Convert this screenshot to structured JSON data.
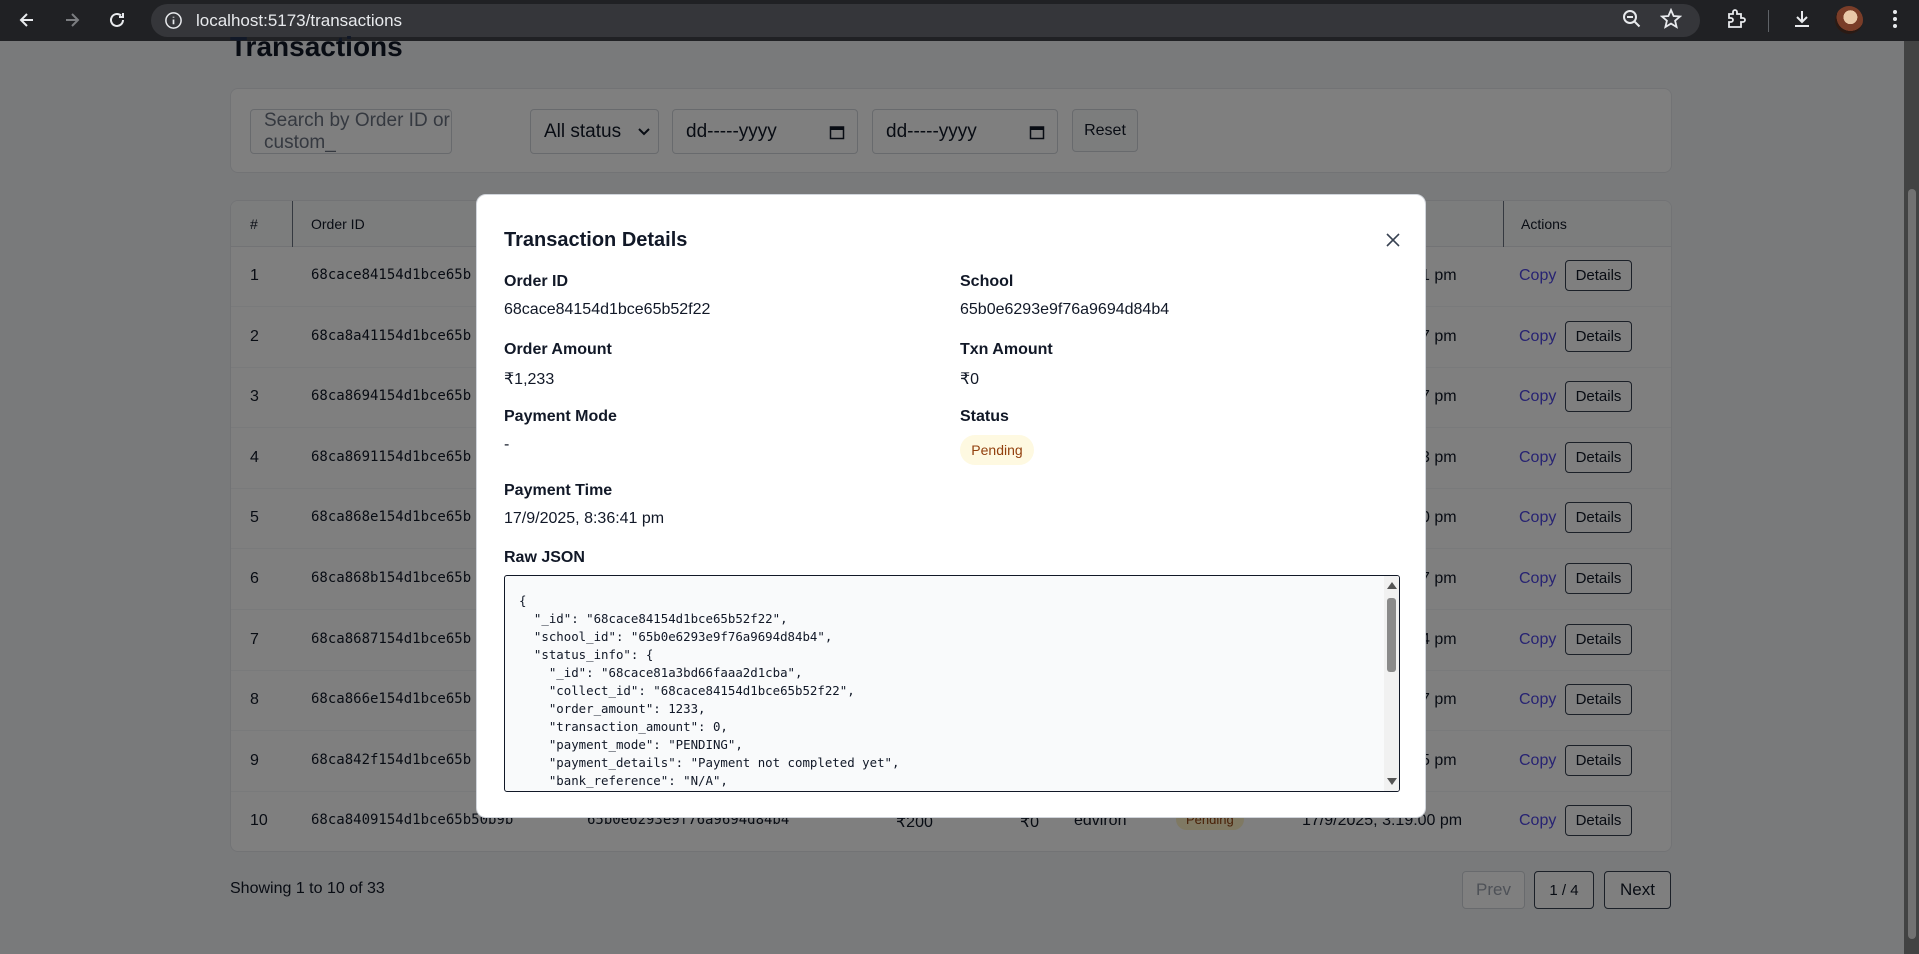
{
  "browser": {
    "url": "localhost:5173/transactions"
  },
  "page": {
    "title": "Transactions",
    "search_placeholder": "Search by Order ID or custom_",
    "status_filter": "All status",
    "date_from": "dd-----yyyy",
    "date_to": "dd-----yyyy",
    "reset_label": "Reset"
  },
  "table": {
    "headers": {
      "index": "#",
      "order_id": "Order ID",
      "actions": "Actions"
    },
    "copy_label": "Copy",
    "details_label": "Details",
    "rows": [
      {
        "index": "1",
        "order_id": "68cace84154d1bce65b",
        "time_suffix": "1 pm"
      },
      {
        "index": "2",
        "order_id": "68ca8a41154d1bce65b",
        "time_suffix": "7 pm"
      },
      {
        "index": "3",
        "order_id": "68ca8694154d1bce65b",
        "time_suffix": "7 pm"
      },
      {
        "index": "4",
        "order_id": "68ca8691154d1bce65b",
        "time_suffix": "3 pm"
      },
      {
        "index": "5",
        "order_id": "68ca868e154d1bce65b",
        "time_suffix": "0 pm"
      },
      {
        "index": "6",
        "order_id": "68ca868b154d1bce65b",
        "time_suffix": "7 pm"
      },
      {
        "index": "7",
        "order_id": "68ca8687154d1bce65b",
        "time_suffix": "4 pm"
      },
      {
        "index": "8",
        "order_id": "68ca866e154d1bce65b",
        "time_suffix": "7 pm"
      },
      {
        "index": "9",
        "order_id": "68ca842f154d1bce65b",
        "time_suffix": "5 pm"
      },
      {
        "index": "10",
        "order_id": "68ca8409154d1bce65b50b9b",
        "school": "65b0e6293e9f76a9694d84b4",
        "order_amount": "₹200",
        "txn_amount": "₹0",
        "gateway": "edviron",
        "status": "Pending",
        "time": "17/9/2025, 3:19:00 pm"
      }
    ]
  },
  "pagination": {
    "showing": "Showing 1 to 10 of 33",
    "prev": "Prev",
    "page": "1 / 4",
    "next": "Next"
  },
  "modal": {
    "title": "Transaction Details",
    "order_id_label": "Order ID",
    "order_id": "68cace84154d1bce65b52f22",
    "school_label": "School",
    "school": "65b0e6293e9f76a9694d84b4",
    "order_amount_label": "Order Amount",
    "order_amount": "₹1,233",
    "txn_amount_label": "Txn Amount",
    "txn_amount": "₹0",
    "payment_mode_label": "Payment Mode",
    "payment_mode": "-",
    "status_label": "Status",
    "status": "Pending",
    "payment_time_label": "Payment Time",
    "payment_time": "17/9/2025, 8:36:41 pm",
    "raw_json_label": "Raw JSON",
    "raw_json": "{\n  \"_id\": \"68cace84154d1bce65b52f22\",\n  \"school_id\": \"65b0e6293e9f76a9694d84b4\",\n  \"status_info\": {\n    \"_id\": \"68cace81a3bd66faaa2d1cba\",\n    \"collect_id\": \"68cace84154d1bce65b52f22\",\n    \"order_amount\": 1233,\n    \"transaction_amount\": 0,\n    \"payment_mode\": \"PENDING\",\n    \"payment_details\": \"Payment not completed yet\",\n    \"bank_reference\": \"N/A\","
  },
  "colors": {
    "link": "#4f46e5",
    "pending_bg": "#fef3c7",
    "pending_text": "#92400e"
  }
}
